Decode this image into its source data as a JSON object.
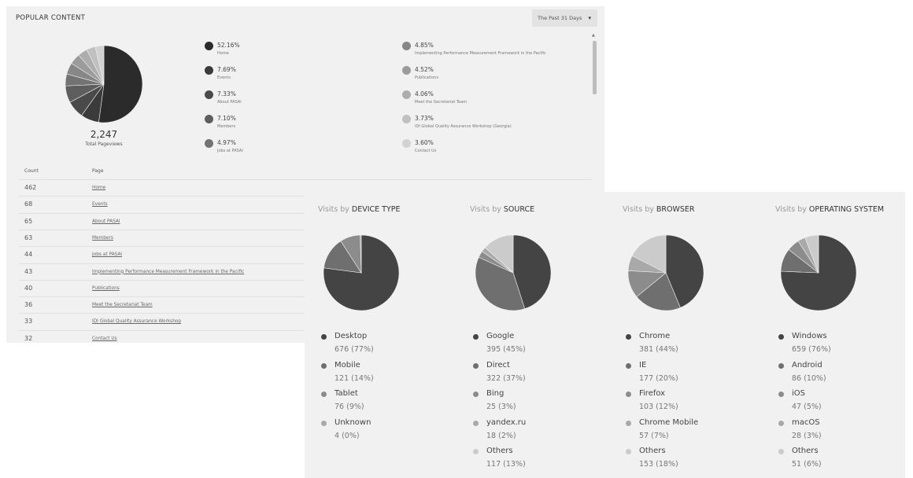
{
  "popular": {
    "title": "POPULAR CONTENT",
    "date_range": "The Past 31 Days",
    "total_value": "2,247",
    "total_label": "Total Pageviews",
    "legend": [
      {
        "pct": "52.16%",
        "name": "Home",
        "color": "#2b2b2b"
      },
      {
        "pct": "7.69%",
        "name": "Events",
        "color": "#3b3b3b"
      },
      {
        "pct": "7.33%",
        "name": "About PASAI",
        "color": "#4a4a4a"
      },
      {
        "pct": "7.10%",
        "name": "Members",
        "color": "#5e5e5e"
      },
      {
        "pct": "4.97%",
        "name": "Jobs at PASAI",
        "color": "#737373"
      },
      {
        "pct": "4.85%",
        "name": "Implementing Performance Measurement Framework in the Pacific",
        "color": "#878787"
      },
      {
        "pct": "4.52%",
        "name": "Publications",
        "color": "#9b9b9b"
      },
      {
        "pct": "4.06%",
        "name": "Meet the Secretariat Team",
        "color": "#adadad"
      },
      {
        "pct": "3.73%",
        "name": "IDI Global Quality Assurance Workshop (Georgia)",
        "color": "#c0c0c0"
      },
      {
        "pct": "3.60%",
        "name": "Contact Us",
        "color": "#d2d2d2"
      }
    ],
    "table": {
      "col_count": "Count",
      "col_page": "Page",
      "rows": [
        {
          "count": "462",
          "page": "Home"
        },
        {
          "count": "68",
          "page": "Events"
        },
        {
          "count": "65",
          "page": "About PASAI"
        },
        {
          "count": "63",
          "page": "Members"
        },
        {
          "count": "44",
          "page": "Jobs at PASAI"
        },
        {
          "count": "43",
          "page": "Implementing Performance Measurement Framework in the Pacific"
        },
        {
          "count": "40",
          "page": "Publications"
        },
        {
          "count": "36",
          "page": "Meet the Secretariat Team"
        },
        {
          "count": "33",
          "page": "IDI Global Quality Assurance Workshop"
        },
        {
          "count": "32",
          "page": "Contact Us"
        }
      ]
    }
  },
  "visits": {
    "prefix": "Visits by",
    "charts": [
      {
        "title": "DEVICE TYPE",
        "items": [
          {
            "label": "Desktop",
            "value": "676 (77%)",
            "count": 676,
            "color": "#444444"
          },
          {
            "label": "Mobile",
            "value": "121 (14%)",
            "count": 121,
            "color": "#6f6f6f"
          },
          {
            "label": "Tablet",
            "value": "76 (9%)",
            "count": 76,
            "color": "#8c8c8c"
          },
          {
            "label": "Unknown",
            "value": "4 (0%)",
            "count": 4,
            "color": "#a9a9a9"
          }
        ]
      },
      {
        "title": "SOURCE",
        "items": [
          {
            "label": "Google",
            "value": "395 (45%)",
            "count": 395,
            "color": "#444444"
          },
          {
            "label": "Direct",
            "value": "322 (37%)",
            "count": 322,
            "color": "#6f6f6f"
          },
          {
            "label": "Bing",
            "value": "25 (3%)",
            "count": 25,
            "color": "#8c8c8c"
          },
          {
            "label": "yandex.ru",
            "value": "18 (2%)",
            "count": 18,
            "color": "#a9a9a9"
          },
          {
            "label": "Others",
            "value": "117 (13%)",
            "count": 117,
            "color": "#cbcbcb"
          }
        ]
      },
      {
        "title": "BROWSER",
        "items": [
          {
            "label": "Chrome",
            "value": "381 (44%)",
            "count": 381,
            "color": "#444444"
          },
          {
            "label": "IE",
            "value": "177 (20%)",
            "count": 177,
            "color": "#6f6f6f"
          },
          {
            "label": "Firefox",
            "value": "103 (12%)",
            "count": 103,
            "color": "#8c8c8c"
          },
          {
            "label": "Chrome Mobile",
            "value": "57 (7%)",
            "count": 57,
            "color": "#a9a9a9"
          },
          {
            "label": "Others",
            "value": "153 (18%)",
            "count": 153,
            "color": "#cbcbcb"
          }
        ]
      },
      {
        "title": "OPERATING SYSTEM",
        "items": [
          {
            "label": "Windows",
            "value": "659 (76%)",
            "count": 659,
            "color": "#444444"
          },
          {
            "label": "Android",
            "value": "86 (10%)",
            "count": 86,
            "color": "#6f6f6f"
          },
          {
            "label": "iOS",
            "value": "47 (5%)",
            "count": 47,
            "color": "#8c8c8c"
          },
          {
            "label": "macOS",
            "value": "28 (3%)",
            "count": 28,
            "color": "#a9a9a9"
          },
          {
            "label": "Others",
            "value": "51 (6%)",
            "count": 51,
            "color": "#cbcbcb"
          }
        ]
      }
    ]
  }
}
